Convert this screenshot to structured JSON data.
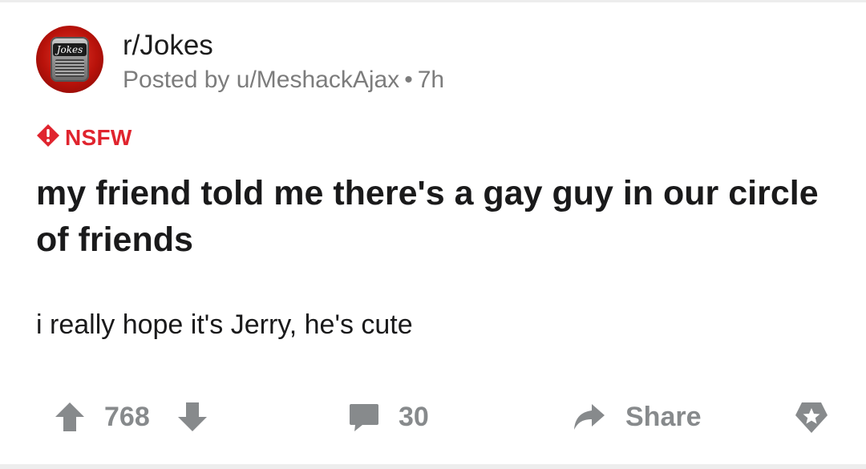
{
  "post": {
    "subreddit": "r/Jokes",
    "subreddit_icon_text": "Jokes",
    "posted_by": "Posted by u/MeshackAjax",
    "separator": "•",
    "time": "7h",
    "nsfw_label": "NSFW",
    "title": "my friend told me there's a gay guy in our circle of friends",
    "body": "i really hope it's Jerry, he's cute"
  },
  "actions": {
    "upvote_icon": "arrow-up-icon",
    "vote_count": "768",
    "downvote_icon": "arrow-down-icon",
    "comment_icon": "speech-bubble-icon",
    "comment_count": "30",
    "share_icon": "share-arrow-icon",
    "share_label": "Share",
    "award_icon": "award-icon"
  },
  "colors": {
    "nsfw_red": "#e0242e",
    "icon_gray": "#878a8c",
    "meta_gray": "#7c7c7c",
    "text_dark": "#1a1a1b"
  }
}
